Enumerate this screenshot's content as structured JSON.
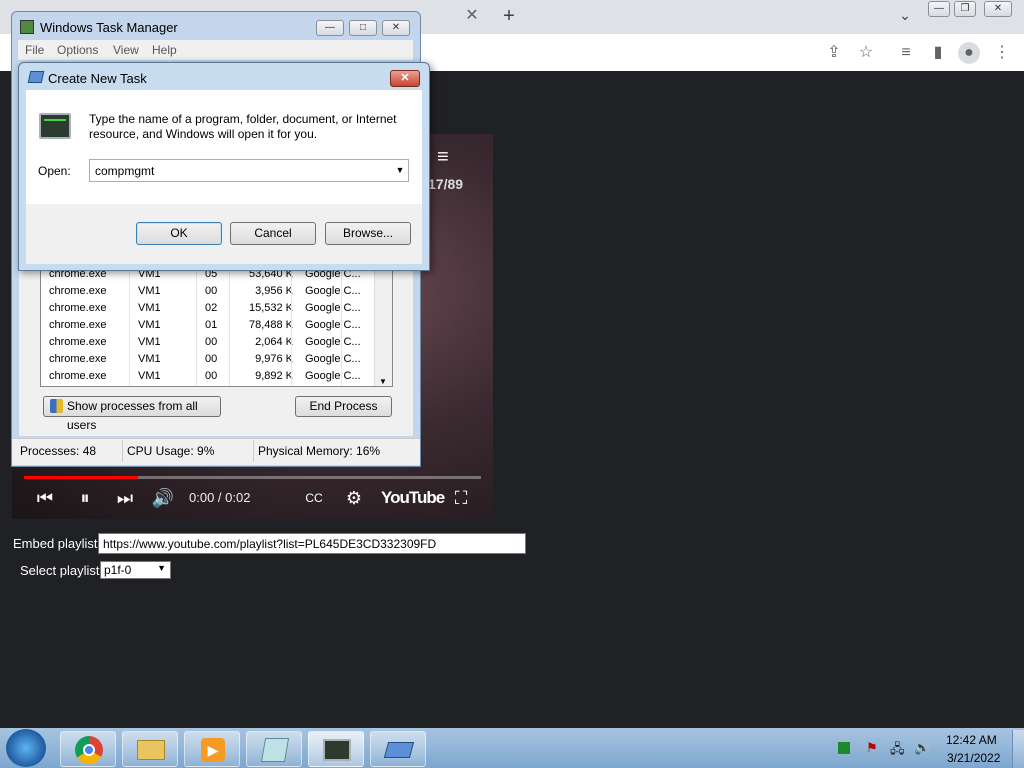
{
  "browser": {
    "tab_close": "✕",
    "new_tab": "+",
    "tab_search": "⌄"
  },
  "video": {
    "playlist_count": "17/89",
    "time": "0:00 / 0:02",
    "brand": "YouTube",
    "progress_fraction": 0.25
  },
  "page": {
    "embed_label": "Embed playlist:",
    "embed_value": "https://www.youtube.com/playlist?list=PL645DE3CD332309FD",
    "select_label": "Select playlist:",
    "select_value": "p1f-0"
  },
  "task_manager": {
    "title": "Windows Task Manager",
    "menu": [
      "File",
      "Options",
      "View",
      "Help"
    ],
    "rows": [
      {
        "name": "chrome.exe",
        "user": "VM1",
        "cpu": "05",
        "mem": "53,640 K",
        "desc": "Google C..."
      },
      {
        "name": "chrome.exe",
        "user": "VM1",
        "cpu": "00",
        "mem": "3,956 K",
        "desc": "Google C..."
      },
      {
        "name": "chrome.exe",
        "user": "VM1",
        "cpu": "02",
        "mem": "15,532 K",
        "desc": "Google C..."
      },
      {
        "name": "chrome.exe",
        "user": "VM1",
        "cpu": "01",
        "mem": "78,488 K",
        "desc": "Google C..."
      },
      {
        "name": "chrome.exe",
        "user": "VM1",
        "cpu": "00",
        "mem": "2,064 K",
        "desc": "Google C..."
      },
      {
        "name": "chrome.exe",
        "user": "VM1",
        "cpu": "00",
        "mem": "9,976 K",
        "desc": "Google C..."
      },
      {
        "name": "chrome.exe",
        "user": "VM1",
        "cpu": "00",
        "mem": "9,892 K",
        "desc": "Google C..."
      }
    ],
    "show_all_label": "Show processes from all users",
    "end_process_label": "End Process",
    "status_processes": "Processes: 48",
    "status_cpu": "CPU Usage: 9%",
    "status_memory": "Physical Memory: 16%"
  },
  "run_dialog": {
    "title": "Create New Task",
    "description": "Type the name of a program, folder, document, or Internet resource, and Windows will open it for you.",
    "open_label": "Open:",
    "open_value": "compmgmt",
    "ok_label": "OK",
    "cancel_label": "Cancel",
    "browse_label": "Browse..."
  },
  "taskbar": {
    "time": "12:42 AM",
    "date": "3/21/2022"
  }
}
